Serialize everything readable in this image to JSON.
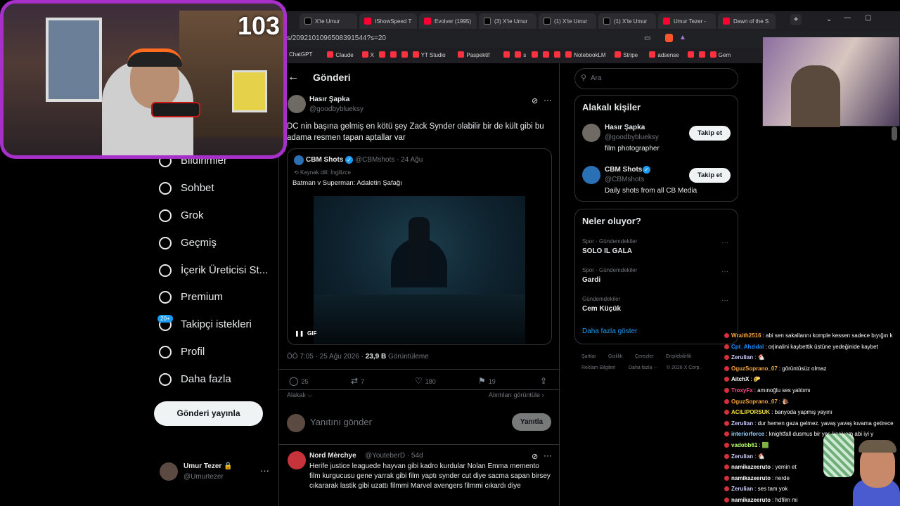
{
  "stream": {
    "viewer_count": "103"
  },
  "browser": {
    "tabs": [
      {
        "label": "X'te Umur",
        "icon": "x"
      },
      {
        "label": "IShowSpeed T",
        "icon": "yt"
      },
      {
        "label": "Evolver (1995)",
        "icon": "yt"
      },
      {
        "label": "(3) X'te Umur",
        "icon": "x"
      },
      {
        "label": "(1) X'te Umur",
        "icon": "x"
      },
      {
        "label": "(1) X'te Umur",
        "icon": "x"
      },
      {
        "label": "Umur Tezer -",
        "icon": "yt"
      },
      {
        "label": "Dawn of the S",
        "icon": "yt"
      }
    ],
    "url": "s/2092101096508391544?s=20",
    "bookmarks": [
      "ChatGPT",
      "Claude",
      "X",
      "",
      "",
      "",
      "YT Studio",
      "Paspektif",
      "",
      "s",
      "",
      "",
      "",
      "NotebookLM",
      "Stripe",
      "adsense",
      "",
      "",
      "Gem"
    ]
  },
  "nav": {
    "items": [
      {
        "label": "Bildirimler",
        "icon": "bell-icon"
      },
      {
        "label": "Sohbet",
        "icon": "chat-icon"
      },
      {
        "label": "Grok",
        "icon": "grok-icon"
      },
      {
        "label": "Geçmiş",
        "icon": "bookmark-icon"
      },
      {
        "label": "İçerik Üreticisi St...",
        "icon": "rocket-icon"
      },
      {
        "label": "Premium",
        "icon": "premium-icon"
      },
      {
        "label": "Takipçi istekleri",
        "icon": "follower-requests-icon"
      },
      {
        "label": "Profil",
        "icon": "profile-icon"
      },
      {
        "label": "Daha fazla",
        "icon": "more-icon"
      }
    ],
    "badge": "20+",
    "post_button": "Gönderi yayınla",
    "me": {
      "name": "Umur Tezer 🔒",
      "handle": "@Umurtezer"
    }
  },
  "post": {
    "page_title": "Gönderi",
    "author_name": "Hasır Şapka",
    "author_handle": "@goodbyblueksy",
    "text": "DC nin başına gelmiş en kötü şey Zack Synder olabilir bir de kült gibi bu adama resmen tapan aptallar var",
    "quote": {
      "name": "CBM Shots",
      "meta": "@CBMshots · 24 Ağu",
      "lang": "Kaynak dili: İngilizce",
      "text": "Batman v Superman: Adaletin Şafağı",
      "media_label": "GIF"
    },
    "time": "ÖÖ 7:05 · 25 Ağu 2026 · ",
    "views": "23,9 B",
    "views_label": " Görüntüleme",
    "stats": {
      "replies": "25",
      "reposts": "7",
      "likes": "180",
      "bookmarks": "19"
    },
    "algo_label": "Alakalı ⌵",
    "quotes_link": "Alıntıları görüntüle ›",
    "reply_placeholder": "Yanıtını gönder",
    "reply_button": "Yanıtla"
  },
  "reply": {
    "name": "Nord Mèrchye",
    "meta": "@YouteberD · 54d",
    "text": "Herife justice leaguede hayvan gibi kadro kurdular Nolan Emma memento film kurgucusu gene yarrak gibi film yaptı synder cut diye sacma sapan birsey cıkararak lastik gibi uzattı filmmi Marvel avengers filmmi cıkardı diye"
  },
  "sidebar": {
    "search_placeholder": "Ara",
    "related_title": "Alakalı kişiler",
    "people": [
      {
        "name": "Hasır Şapka",
        "handle": "@goodbyblueksy",
        "bio": "film photographer",
        "follow": "Takip et",
        "verified": false
      },
      {
        "name": "CBM Shots",
        "handle": "@CBMshots",
        "bio": "Daily shots from all CB Media",
        "follow": "Takip et",
        "verified": true
      }
    ],
    "trends_title": "Neler oluyor?",
    "trends": [
      {
        "category": "Spor · Gündemdekiler",
        "title": "SOLO IL GALA"
      },
      {
        "category": "Spor · Gündemdekiler",
        "title": "Gardi"
      },
      {
        "category": "Gündemdekiler",
        "title": "Cem Küçük"
      }
    ],
    "show_more": "Daha fazla göster",
    "footer": [
      "Şartlar",
      "Gizlilik",
      "Çerezler",
      "Erişilebilirlik",
      "Reklam Bilgileri",
      "Daha fazla ···",
      "© 2026 X Corp."
    ]
  },
  "chat": [
    {
      "user": "Wraith2516",
      "msg": ": abi sen sakallarını komple kessen sadece bıyığın k",
      "color": "#f4a340"
    },
    {
      "user": "Cpt_Ahzidal",
      "msg": ": orjinalini kaybettik üstüne yedeğinide kaybet",
      "color": "#1e90ff"
    },
    {
      "user": "Zerulian",
      "msg": ": 🐔",
      "color": "#cfcfff"
    },
    {
      "user": "OguzSoprano_07",
      "msg": ": görüntüsüz olmaz",
      "color": "#f4a340"
    },
    {
      "user": "AitchX",
      "msg": ": 🌮",
      "color": "#ffffff"
    },
    {
      "user": "TroxyFx",
      "msg": ": amınoğlu ses yalıtımı",
      "color": "#ff4f8b"
    },
    {
      "user": "OguzSoprano_07",
      "msg": ": 🐌",
      "color": "#f4a340"
    },
    {
      "user": "ACILIPORSUK",
      "msg": ": banyoda yapmış yayını",
      "color": "#f4e242"
    },
    {
      "user": "Zerulian",
      "msg": ": dur hemen gaza gelmez. yavaş yavaş kıvama getirece",
      "color": "#cfcfff"
    },
    {
      "user": "interiorforce",
      "msg": ": knightfall dusmus bir yer. kaciyom abi iyi y",
      "color": "#9ad0ff"
    },
    {
      "user": "vadobb61",
      "msg": ": 🟩",
      "color": "#b6ff6b"
    },
    {
      "user": "Zerulian",
      "msg": ": 🐔",
      "color": "#cfcfff"
    },
    {
      "user": "namikazeeruto",
      "msg": ": yemin et",
      "color": "#ffffff"
    },
    {
      "user": "namikazeeruto",
      "msg": ": nerde",
      "color": "#ffffff"
    },
    {
      "user": "Zerulian",
      "msg": ": ses tam yok",
      "color": "#cfcfff"
    },
    {
      "user": "namikazeeruto",
      "msg": ": hdfilm mi",
      "color": "#ffffff"
    }
  ]
}
